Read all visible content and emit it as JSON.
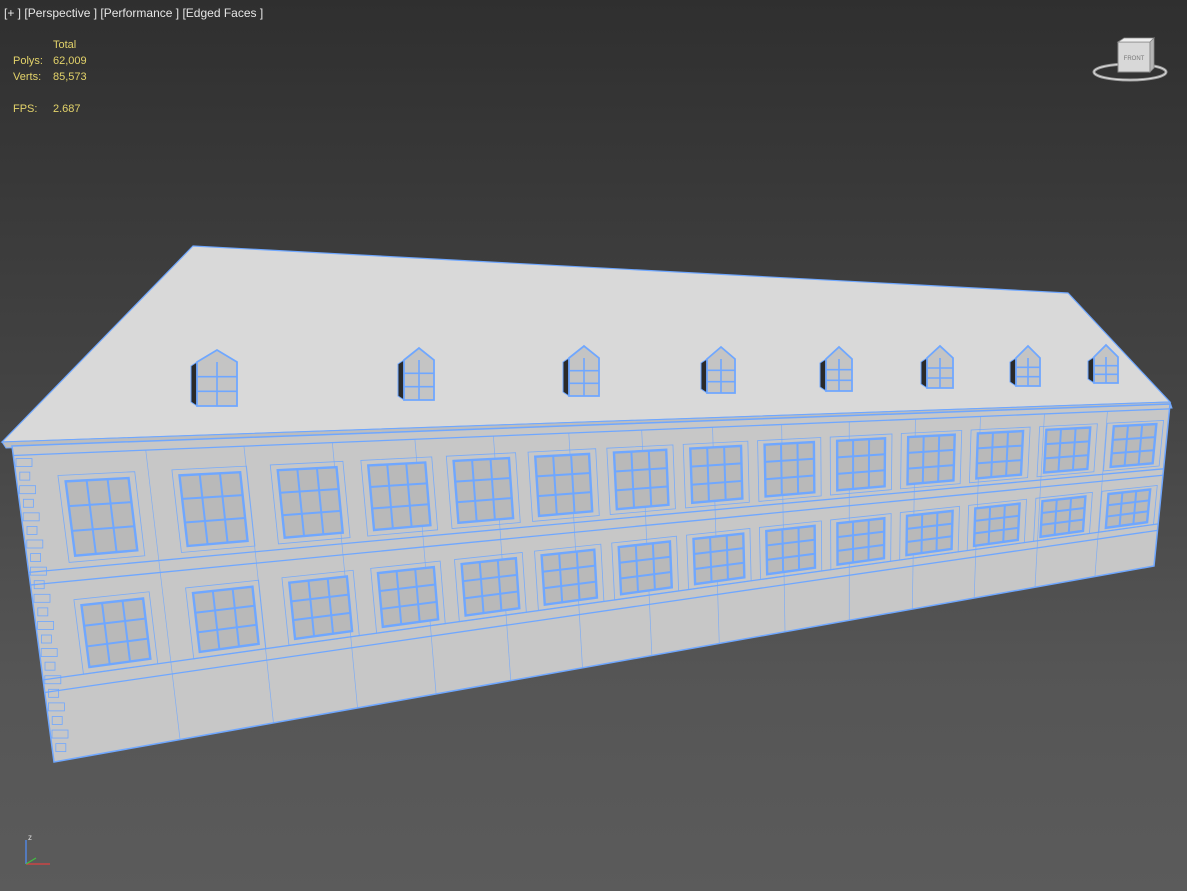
{
  "viewport_menu": {
    "plus": "[+ ]",
    "view": "[Perspective ]",
    "performance": "[Performance ]",
    "shading": "[Edged Faces ]"
  },
  "stats": {
    "header": "Total",
    "polys_label": "Polys:",
    "polys_value": "62,009",
    "verts_label": "Verts:",
    "verts_value": "85,573",
    "fps_label": "FPS:",
    "fps_value": "2.687"
  },
  "viewcube": {
    "face_label": "FRONT"
  },
  "axis": {
    "z_label": "z"
  },
  "colors": {
    "wire": "#6fa7ff",
    "wall": "#c7c7c7",
    "roof": "#d9d9d9",
    "stats_text": "#e3d36a"
  },
  "model": {
    "dormer_count": 8,
    "upper_windows": 14,
    "lower_windows": 14
  }
}
